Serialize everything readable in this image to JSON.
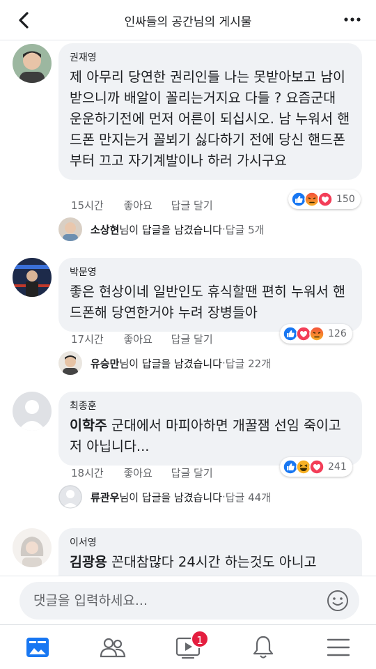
{
  "header": {
    "title": "인싸들의 공간님의 게시물"
  },
  "comments": [
    {
      "author": "권재영",
      "mention": "",
      "text": "제 아무리 당연한 권리인들 나는 못받아보고 남이 받으니까 배알이 꼴리는거지요 다들 ? 요즘군대 운운하기전에 먼저 어른이 되십시오. 남 누워서 핸드폰 만지는거 꼴뵈기 싫다하기 전에 당신 핸드폰부터 끄고 자기계발이나 하러 가시구요",
      "time": "15시간",
      "like": "좋아요",
      "reply": "답글 달기",
      "reaction_count": "150",
      "reactions": [
        "like",
        "angry",
        "love"
      ],
      "replies": {
        "name": "소상현",
        "suffix": "님이 답글을 남겼습니다",
        "dot": " · ",
        "count": "답글 5개"
      }
    },
    {
      "author": "박문영",
      "mention": "",
      "text": "좋은 현상이네 일반인도 휴식할땐 편히 누워서 핸드폰해 당연한거야 누려 장병들아",
      "time": "17시간",
      "like": "좋아요",
      "reply": "답글 달기",
      "reaction_count": "126",
      "reactions": [
        "like",
        "love",
        "angry"
      ],
      "replies": {
        "name": "유승만",
        "suffix": "님이 답글을 남겼습니다",
        "dot": " · ",
        "count": "답글 22개"
      }
    },
    {
      "author": "최종훈",
      "mention": "이학주",
      "text": " 군대에서 마피아하면 개꿀잼 선임 죽이고 저 아닙니다...",
      "time": "18시간",
      "like": "좋아요",
      "reply": "답글 달기",
      "reaction_count": "241",
      "reactions": [
        "like",
        "haha",
        "love"
      ],
      "replies": {
        "name": "류관우",
        "suffix": "님이 답글을 남겼습니다",
        "dot": " · ",
        "count": "답글 44개"
      }
    },
    {
      "author": "이서영",
      "mention": "김광용",
      "text": " 꼰대참많다 24시간 하는것도 아니고"
    }
  ],
  "composer": {
    "placeholder": "댓글을 입력하세요..."
  },
  "tabbar": {
    "video_badge": "1"
  },
  "colors": {
    "like": "#1877f2",
    "love": "#f33e58",
    "angry": "#f7b125",
    "badge": "#e41e3f"
  }
}
